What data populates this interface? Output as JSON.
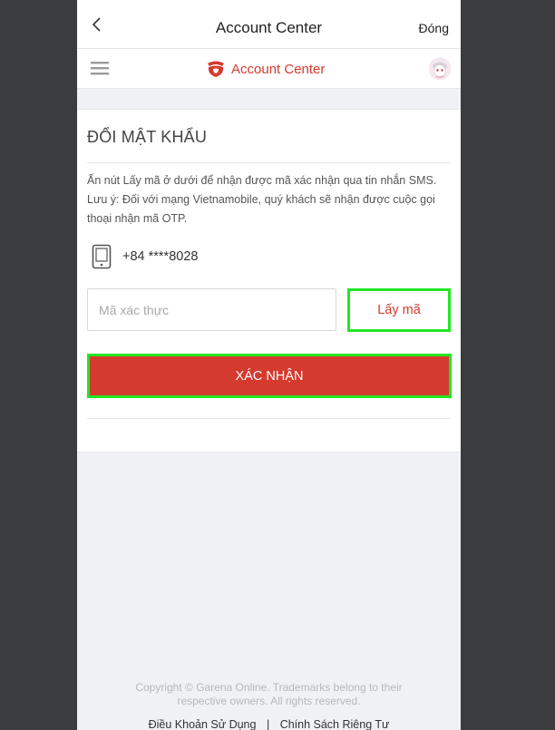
{
  "nav": {
    "title": "Account Center",
    "close_label": "Đóng",
    "back_icon": "chevron-left-icon"
  },
  "brand": {
    "name": "Account Center",
    "logo_icon": "garena-logo-icon",
    "menu_icon": "hamburger-menu-icon",
    "color": "#d53a2f"
  },
  "form": {
    "title": "ĐỔI MẬT KHẨU",
    "description": "Ấn nút Lấy mã ở dưới để nhận được mã xác nhận qua tin nhắn SMS. Lưu ý: Đối với mạng Vietnamobile, quý khách sẽ nhận được cuộc gọi thoại nhận mã OTP.",
    "phone_icon": "mobile-device-icon",
    "phone_number": "+84 ****8028",
    "code_placeholder": "Mã xác thực",
    "code_value": "",
    "get_code_label": "Lấy mã",
    "confirm_label": "XÁC NHẬN"
  },
  "footer": {
    "copyright_line1": "Copyright © Garena Online. Trademarks belong to their",
    "copyright_line2": "respective owners. All rights reserved.",
    "terms_label": "Điều Khoản Sử Dụng",
    "separator": "|",
    "privacy_label": "Chính Sách Riêng Tư"
  },
  "colors": {
    "accent": "#d53a2f",
    "highlight": "#22e622",
    "background": "#f0f1f5",
    "outer": "#3b3c3e"
  }
}
